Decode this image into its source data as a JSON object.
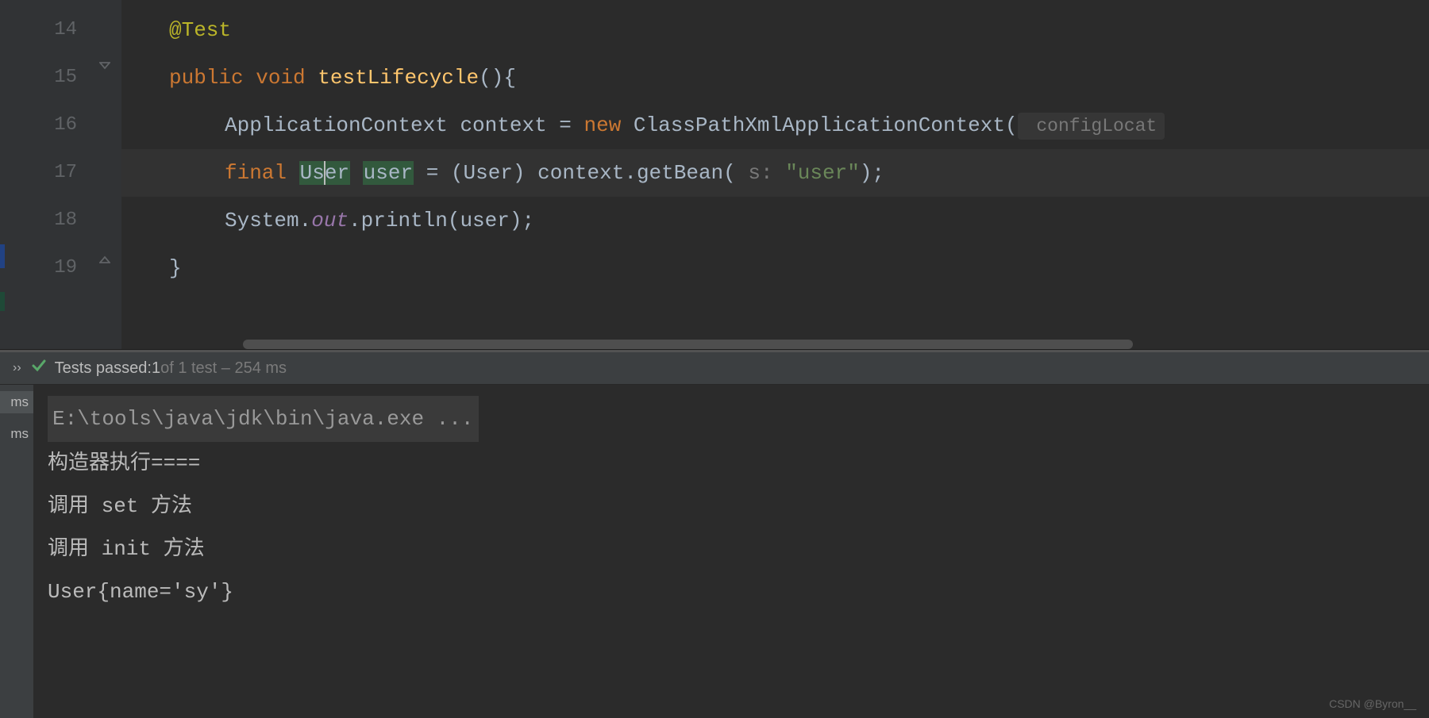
{
  "editor": {
    "lines": [
      {
        "num": "14"
      },
      {
        "num": "15"
      },
      {
        "num": "16"
      },
      {
        "num": "17"
      },
      {
        "num": "18"
      },
      {
        "num": "19"
      }
    ],
    "line14": {
      "annotation": "@Test"
    },
    "line15": {
      "public": "public",
      "void": "void",
      "method": "testLifecycle",
      "parens": "(){"
    },
    "line16": {
      "t1": "ApplicationContext context = ",
      "new": "new",
      "t2": " ClassPathXmlApplicationContext(",
      "hint": " configLocat"
    },
    "line17": {
      "final": "final",
      "sp1": " ",
      "type_before": "Us",
      "type_after": "er",
      "sp2": " ",
      "var": "user",
      "t3": " = (User) context.getBean( ",
      "paramlabel": "s:",
      "sp3": " ",
      "str": "\"user\"",
      "t4": ");"
    },
    "line18": {
      "t1": "System.",
      "out": "out",
      "t2": ".println(user);"
    },
    "line19": {
      "brace": "}"
    }
  },
  "testbar": {
    "passed": "Tests passed:",
    "count": " 1",
    "of": " of 1 test – 254 ms"
  },
  "console": {
    "tabs": [
      "ms",
      "ms"
    ],
    "cmd": "E:\\tools\\java\\jdk\\bin\\java.exe ...",
    "out1": "构造器执行====",
    "out2": "调用 set 方法",
    "out3": "调用 init 方法",
    "out4": "User{name='sy'}"
  },
  "watermark": "CSDN @Byron__"
}
